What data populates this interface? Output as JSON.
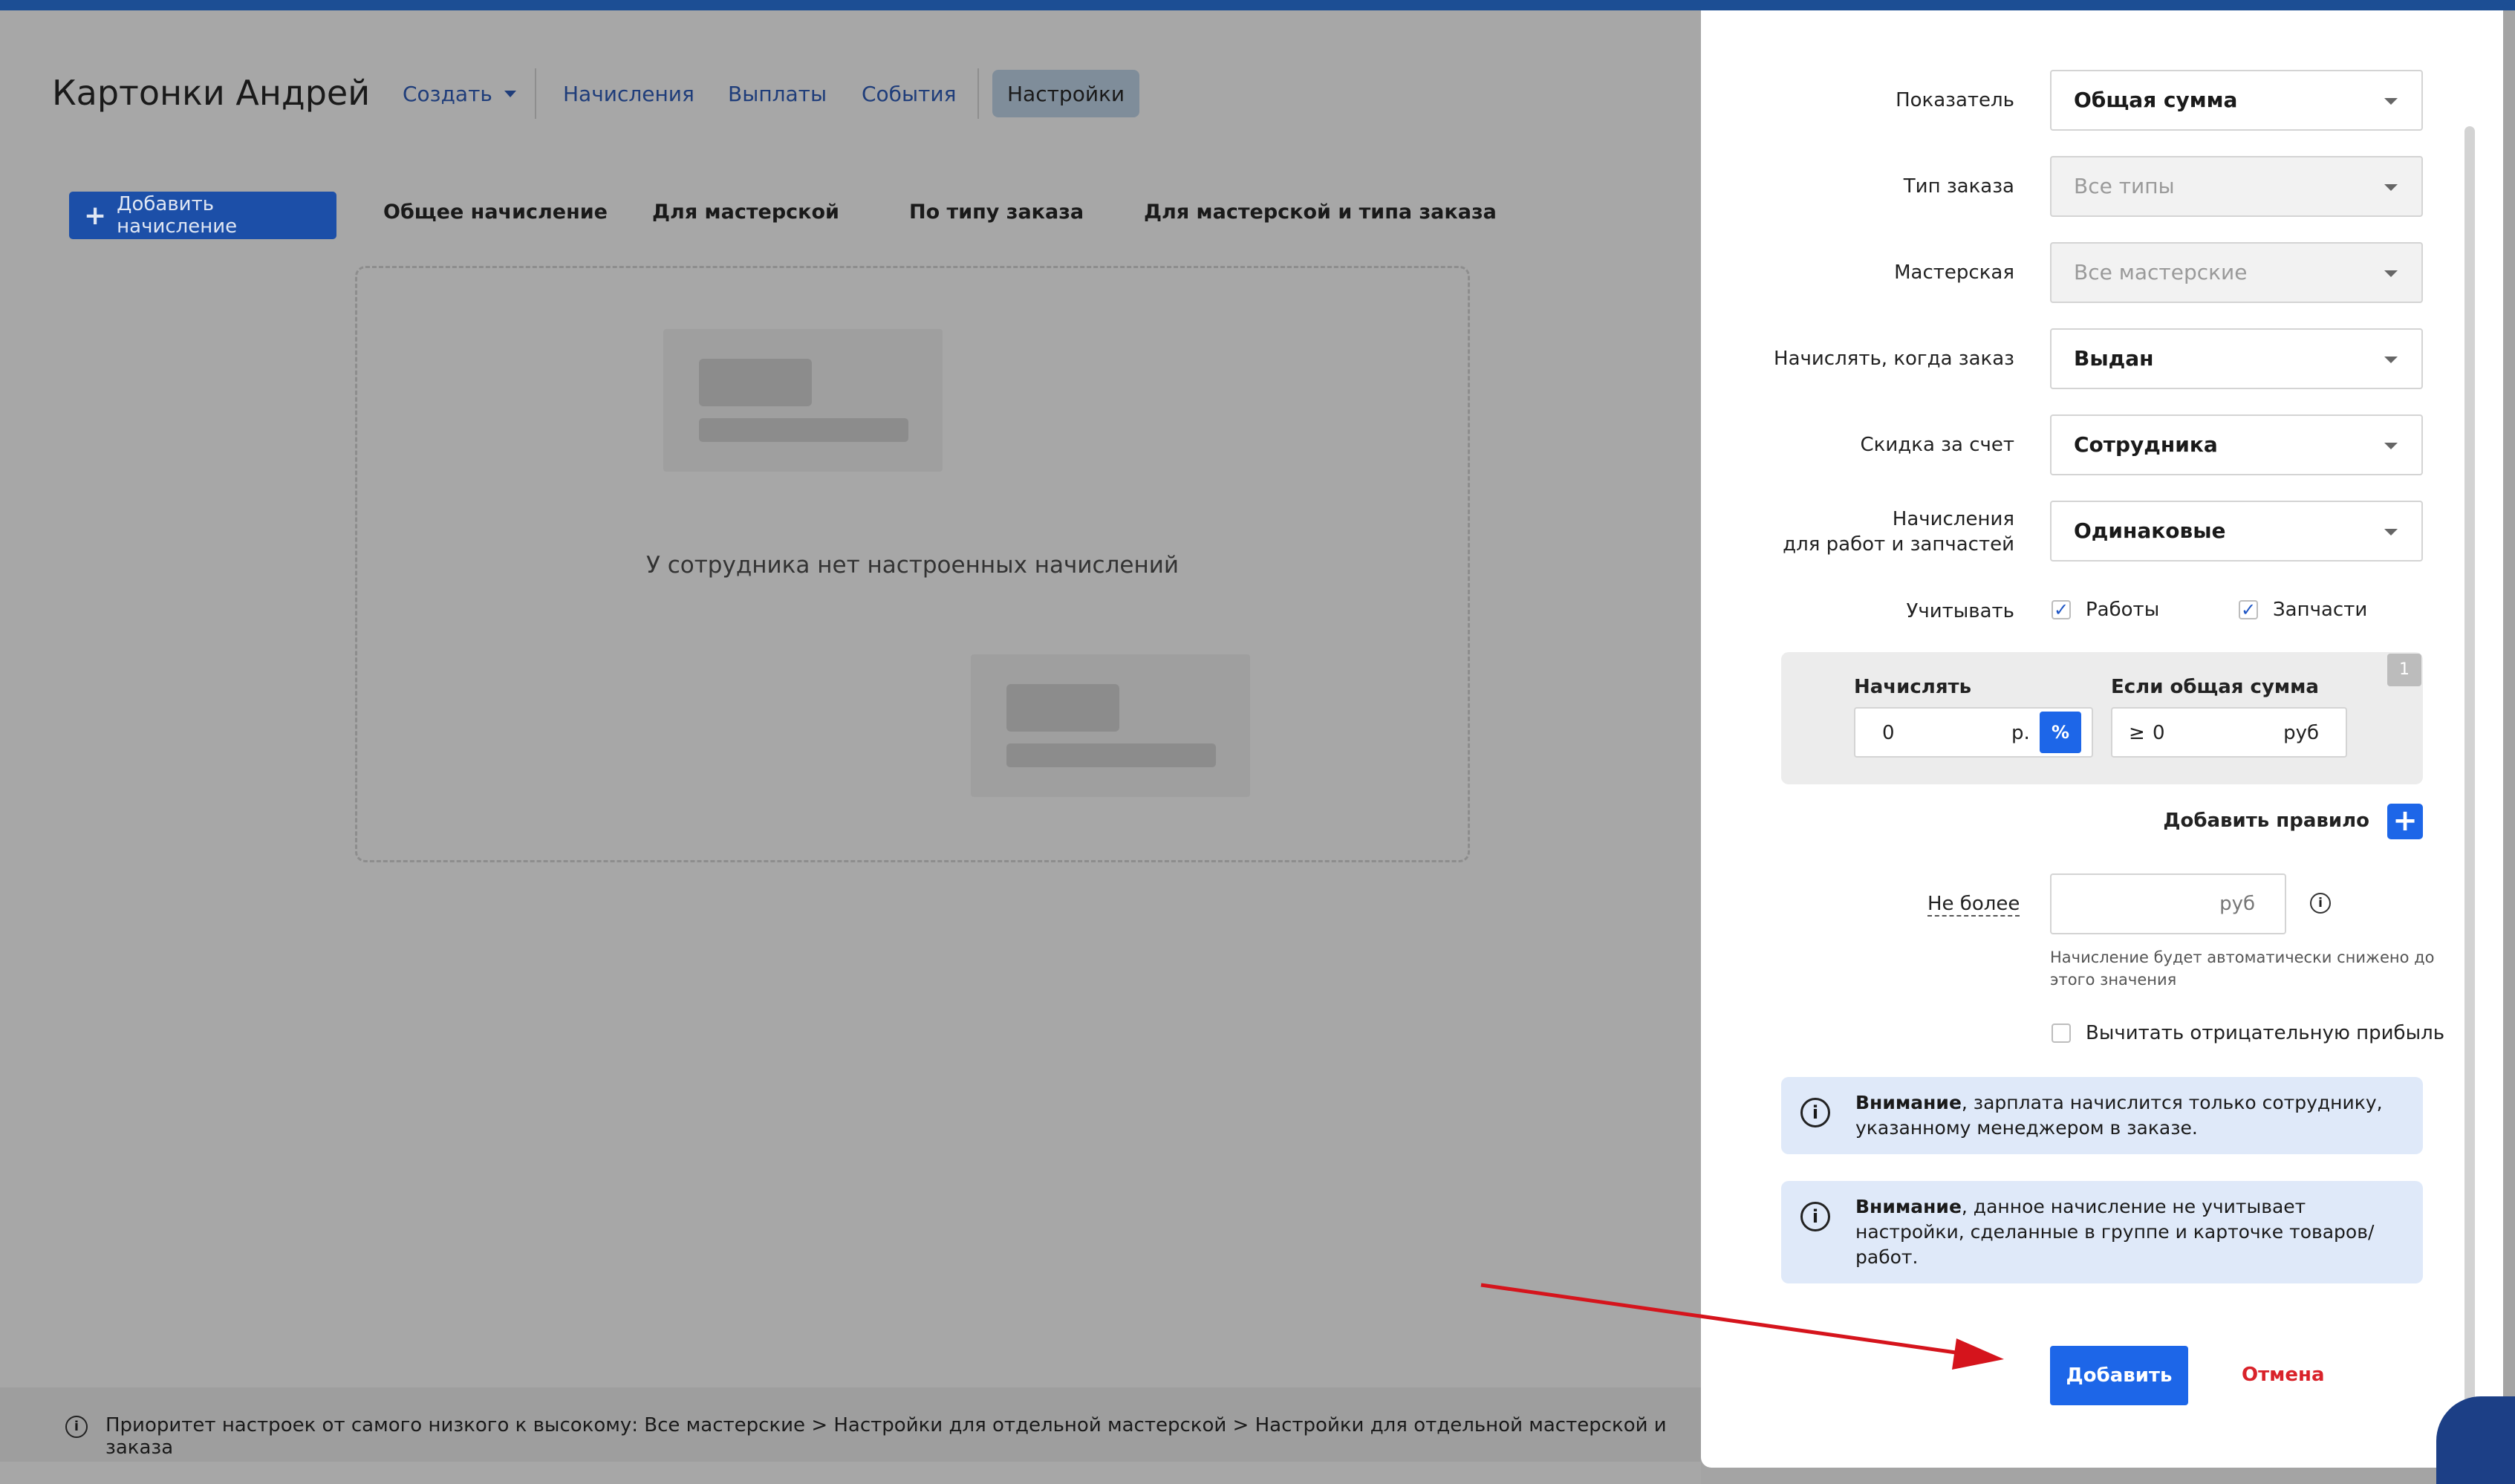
{
  "header": {
    "title": "Картонки Андрей",
    "nav": [
      "Создать",
      "Начисления",
      "Выплаты",
      "События",
      "Настройки"
    ]
  },
  "toolbar": {
    "add_button": "Добавить начисление",
    "tabs": [
      "Общее начисление",
      "Для мастерской",
      "По типу заказа",
      "Для мастерской и типа заказа"
    ]
  },
  "empty_state": {
    "text": "У сотрудника нет настроенных начислений"
  },
  "footer": {
    "text": "Приоритет настроек от самого низкого к высокому: Все мастерские > Настройки для отдельной мастерской > Настройки для отдельной мастерской и заказа"
  },
  "form": {
    "fields": [
      {
        "label": "Показатель",
        "value": "Общая сумма"
      },
      {
        "label": "Тип заказа",
        "value": "Все типы"
      },
      {
        "label": "Мастерская",
        "value": "Все мастерские"
      },
      {
        "label": "Начислять, когда заказ",
        "value": "Выдан"
      },
      {
        "label": "Скидка за счет",
        "value": "Сотрудника"
      },
      {
        "label_line1": "Начисления",
        "label_line2": "для работ и запчастей",
        "value": "Одинаковые"
      }
    ],
    "consider": {
      "label": "Учитывать",
      "options": [
        {
          "label": "Работы",
          "checked": true
        },
        {
          "label": "Запчасти",
          "checked": true
        }
      ]
    },
    "rule": {
      "index": "1",
      "accrue_label": "Начислять",
      "accrue_value": "0",
      "accrue_unit": "р.",
      "percent_label": "%",
      "condition_label": "Если общая сумма",
      "condition_sign": "≥",
      "condition_value": "0",
      "condition_unit": "руб"
    },
    "add_rule_label": "Добавить правило",
    "max": {
      "label": "Не более",
      "unit": "руб",
      "hint_line1": "Начисление будет автоматически снижено до",
      "hint_line2": "этого значения"
    },
    "negative_profit": {
      "label": "Вычитать отрицательную прибыль",
      "checked": false
    },
    "notes": [
      {
        "bold": "Внимание",
        "line1": ", зарплата начислится только сотруднику,",
        "line2": "указанному менеджером в заказе."
      },
      {
        "bold": "Внимание",
        "line1": ", данное начисление не учитывает",
        "line2": "настройки, сделанные в группе и карточке товаров/",
        "line3": "работ."
      }
    ],
    "submit_label": "Добавить",
    "cancel_label": "Отмена"
  },
  "colors": {
    "primary": "#1d66e8",
    "cancel": "#d9222a",
    "annotation_arrow": "#d5141c",
    "note_bg": "#dfe9f9"
  }
}
